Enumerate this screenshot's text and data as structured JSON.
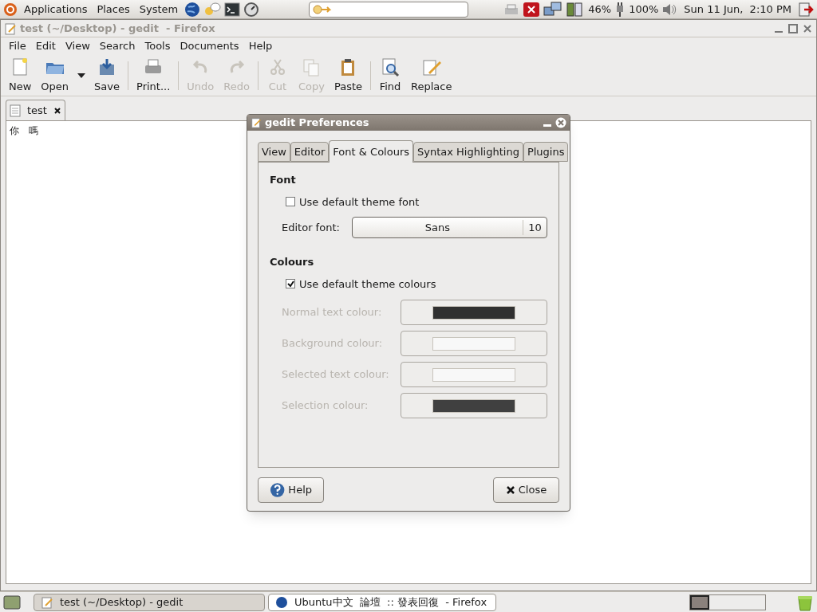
{
  "top_panel": {
    "menus": [
      "Applications",
      "Places",
      "System"
    ],
    "battery": "46%",
    "power": "100%",
    "clock": "Sun 11 Jun,  2:10 PM"
  },
  "window": {
    "title": "test (~/Desktop) - gedit  - Firefox"
  },
  "menu": [
    "File",
    "Edit",
    "View",
    "Search",
    "Tools",
    "Documents",
    "Help"
  ],
  "toolbar": [
    {
      "label": "New",
      "kind": "new",
      "disabled": false
    },
    {
      "label": "Open",
      "kind": "open",
      "disabled": false
    },
    {
      "label": "Save",
      "kind": "save",
      "disabled": false
    },
    {
      "label": "Print...",
      "kind": "print",
      "disabled": false
    },
    {
      "label": "Undo",
      "kind": "undo",
      "disabled": true
    },
    {
      "label": "Redo",
      "kind": "redo",
      "disabled": true
    },
    {
      "label": "Cut",
      "kind": "cut",
      "disabled": true
    },
    {
      "label": "Copy",
      "kind": "copy",
      "disabled": true
    },
    {
      "label": "Paste",
      "kind": "paste",
      "disabled": false
    },
    {
      "label": "Find",
      "kind": "find",
      "disabled": false
    },
    {
      "label": "Replace",
      "kind": "replace",
      "disabled": false
    }
  ],
  "doc_tabs": [
    {
      "label": "test",
      "selected": true
    }
  ],
  "editor": {
    "text": "你　嗎"
  },
  "dialog": {
    "title": "gedit Preferences",
    "tabs": [
      {
        "label": "View",
        "selected": false
      },
      {
        "label": "Editor",
        "selected": false
      },
      {
        "label": "Font & Colours",
        "selected": true
      },
      {
        "label": "Syntax Highlighting",
        "selected": false
      },
      {
        "label": "Plugins",
        "selected": false
      }
    ],
    "font_heading": "Font",
    "use_theme_font": {
      "label": "Use default theme font",
      "checked": false
    },
    "editor_font": {
      "label": "Editor font:",
      "family": "Sans",
      "size": "10"
    },
    "colours_heading": "Colours",
    "use_theme_colours": {
      "label": "Use default theme colours",
      "checked": true
    },
    "colours": [
      {
        "label": "Normal text colour:",
        "color": "#303030",
        "disabled": true
      },
      {
        "label": "Background colour:",
        "color": "#f8f8f8",
        "disabled": true
      },
      {
        "label": "Selected text colour:",
        "color": "#f8f8f8",
        "disabled": true
      },
      {
        "label": "Selection colour:",
        "color": "#404040",
        "disabled": true
      }
    ],
    "buttons": [
      {
        "label": "Help",
        "kind": "help"
      },
      {
        "label": "Close",
        "kind": "close"
      }
    ]
  },
  "taskbar": [
    {
      "label": "test (~/Desktop) - gedit",
      "selected": true,
      "kind": "gedit"
    },
    {
      "label": "Ubuntu中文  論壇  :: 發表回復  - Firefox",
      "selected": false,
      "kind": "firefox"
    }
  ]
}
